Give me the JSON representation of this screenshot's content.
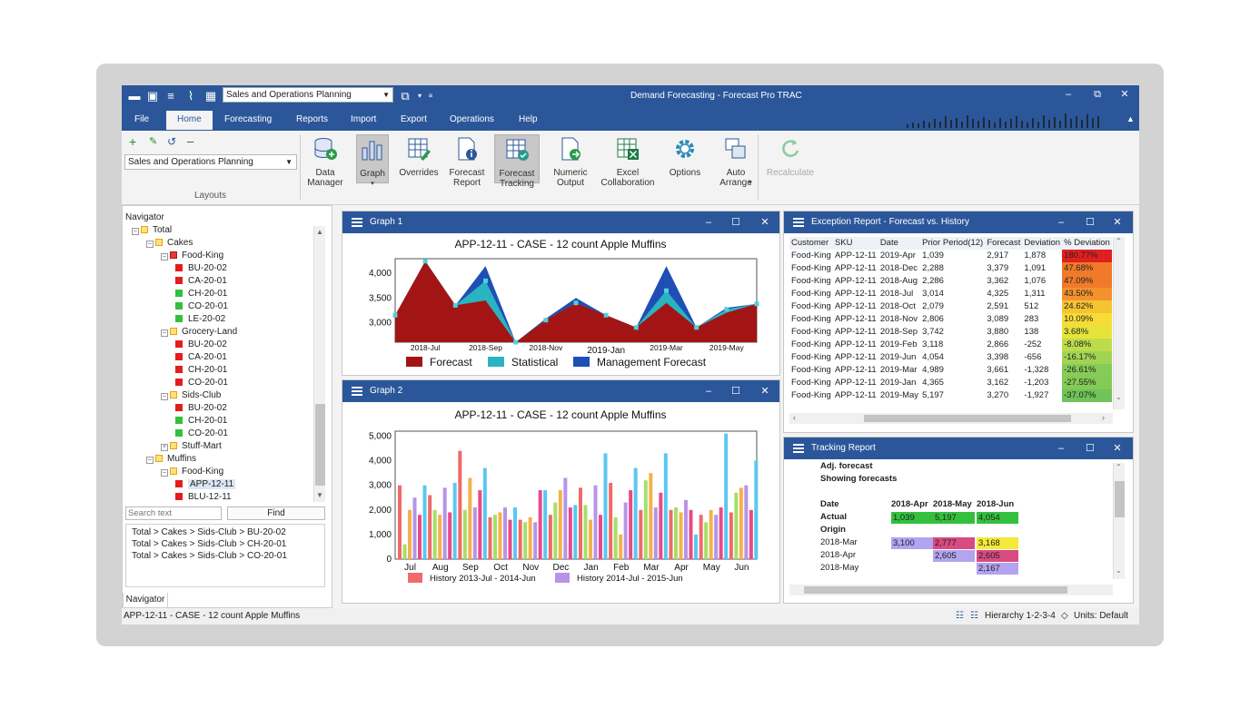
{
  "app": {
    "title": "Demand Forecasting - Forecast Pro TRAC",
    "layout_select": "Sales and Operations Planning"
  },
  "menu": {
    "tabs": [
      "File",
      "Home",
      "Forecasting",
      "Reports",
      "Import",
      "Export",
      "Operations",
      "Help"
    ],
    "active": "Home"
  },
  "ribbon": {
    "layouts_select": "Sales and Operations Planning",
    "layouts_label": "Layouts",
    "buttons": [
      {
        "label": "Data\nManager",
        "icon": "database-add-icon"
      },
      {
        "label": "Graph",
        "icon": "bar-chart-icon"
      },
      {
        "label": "Overrides",
        "icon": "grid-edit-icon"
      },
      {
        "label": "Forecast\nReport",
        "icon": "report-info-icon"
      },
      {
        "label": "Forecast\nTracking",
        "icon": "grid-tracking-icon"
      },
      {
        "label": "Numeric\nOutput",
        "icon": "document-export-icon"
      },
      {
        "label": "Excel\nCollaboration",
        "icon": "excel-icon"
      },
      {
        "label": "Options",
        "icon": "gear-icon"
      },
      {
        "label": "Auto\nArrange",
        "icon": "windows-arrange-icon"
      },
      {
        "label": "Recalculate",
        "icon": "refresh-icon"
      }
    ],
    "accent": "#2b579a"
  },
  "navigator": {
    "title": "Navigator",
    "tab_label": "Navigator",
    "search_placeholder": "Search text",
    "find_label": "Find",
    "tree": [
      {
        "label": "Total",
        "level": 0,
        "kind": "folder"
      },
      {
        "label": "Cakes",
        "level": 1,
        "kind": "folder"
      },
      {
        "label": "Food-King",
        "level": 2,
        "kind": "folder-red"
      },
      {
        "label": "BU-20-02",
        "level": 3,
        "kind": "red"
      },
      {
        "label": "CA-20-01",
        "level": 3,
        "kind": "red"
      },
      {
        "label": "CH-20-01",
        "level": 3,
        "kind": "green"
      },
      {
        "label": "CO-20-01",
        "level": 3,
        "kind": "green"
      },
      {
        "label": "LE-20-02",
        "level": 3,
        "kind": "green"
      },
      {
        "label": "Grocery-Land",
        "level": 2,
        "kind": "folder"
      },
      {
        "label": "BU-20-02",
        "level": 3,
        "kind": "red"
      },
      {
        "label": "CA-20-01",
        "level": 3,
        "kind": "red"
      },
      {
        "label": "CH-20-01",
        "level": 3,
        "kind": "red"
      },
      {
        "label": "CO-20-01",
        "level": 3,
        "kind": "red"
      },
      {
        "label": "Sids-Club",
        "level": 2,
        "kind": "folder"
      },
      {
        "label": "BU-20-02",
        "level": 3,
        "kind": "red"
      },
      {
        "label": "CH-20-01",
        "level": 3,
        "kind": "green"
      },
      {
        "label": "CO-20-01",
        "level": 3,
        "kind": "green"
      },
      {
        "label": "Stuff-Mart",
        "level": 2,
        "kind": "folder-collapsed"
      },
      {
        "label": "Muffins",
        "level": 1,
        "kind": "folder"
      },
      {
        "label": "Food-King",
        "level": 2,
        "kind": "folder"
      },
      {
        "label": "APP-12-11",
        "level": 3,
        "kind": "red-selected"
      },
      {
        "label": "BLU-12-11",
        "level": 3,
        "kind": "red"
      }
    ],
    "results": [
      "Total > Cakes > Sids-Club > BU-20-02",
      "Total > Cakes > Sids-Club > CH-20-01",
      "Total > Cakes > Sids-Club > CO-20-01"
    ]
  },
  "graph1": {
    "panel_title": "Graph 1",
    "legend": [
      {
        "name": "Forecast",
        "color": "#a31515"
      },
      {
        "name": "Statistical",
        "color": "#2ab3c0"
      },
      {
        "name": "Management Forecast",
        "color": "#1f4fb5"
      }
    ]
  },
  "graph2": {
    "panel_title": "Graph 2",
    "colors": [
      "#f06a6a",
      "#a4e06a",
      "#f5b14a",
      "#b794e6",
      "#e84a8a",
      "#5ac8f0"
    ],
    "legend": [
      {
        "name": "History 2013-Jul - 2014-Jun",
        "color": "#f06a6a"
      },
      {
        "name": "History 2014-Jul - 2015-Jun",
        "color": "#b794e6"
      }
    ]
  },
  "chart_data": [
    {
      "type": "area",
      "title": "APP-12-11 - CASE - 12 count Apple Muffins",
      "x": [
        "2018-Jun",
        "2018-Jul",
        "2018-Aug",
        "2018-Sep",
        "2018-Oct",
        "2018-Nov",
        "2018-Dec",
        "2019-Jan",
        "2019-Feb",
        "2019-Mar",
        "2019-Apr",
        "2019-May",
        "2019-Jun"
      ],
      "x_tick_labels": [
        "2018-Jul",
        "2018-Sep",
        "2018-Nov",
        "2019-Jan",
        "2019-Mar",
        "2019-May"
      ],
      "y_tick_labels": [
        "3,000",
        "3,500",
        "4,000"
      ],
      "ylim": [
        2600,
        4300
      ],
      "series": [
        {
          "name": "Forecast",
          "values": [
            3150,
            4250,
            3350,
            3450,
            2600,
            3050,
            3400,
            3150,
            2900,
            3400,
            2900,
            3200,
            3380
          ]
        },
        {
          "name": "Statistical",
          "values": [
            3150,
            4250,
            3350,
            3850,
            2600,
            3050,
            3400,
            3150,
            2900,
            3650,
            2900,
            3270,
            3380
          ]
        },
        {
          "name": "Management Forecast",
          "values": [
            3150,
            4250,
            3350,
            4150,
            2600,
            3080,
            3500,
            3150,
            2900,
            4150,
            2900,
            3300,
            3380
          ]
        }
      ]
    },
    {
      "type": "bar",
      "title": "APP-12-11 - CASE - 12 count Apple Muffins",
      "categories": [
        "Jul",
        "Aug",
        "Sep",
        "Oct",
        "Nov",
        "Dec",
        "Jan",
        "Feb",
        "Mar",
        "Apr",
        "May",
        "Jun"
      ],
      "y_tick_labels": [
        "0",
        "1,000",
        "2,000",
        "3,000",
        "4,000",
        "5,000"
      ],
      "ylim": [
        0,
        5200
      ],
      "series": [
        {
          "values": [
            3000,
            2600,
            4400,
            1700,
            1600,
            1800,
            2900,
            3100,
            2000,
            2000,
            1800,
            1900
          ]
        },
        {
          "values": [
            600,
            2000,
            2000,
            1800,
            1500,
            2300,
            2200,
            1700,
            3200,
            2100,
            1500,
            2700
          ]
        },
        {
          "values": [
            2000,
            1800,
            3300,
            1900,
            1700,
            2800,
            1600,
            1000,
            3500,
            1900,
            2000,
            2900
          ]
        },
        {
          "values": [
            2500,
            2900,
            2100,
            2100,
            1500,
            3300,
            3000,
            2300,
            2100,
            2400,
            1800,
            3000
          ]
        },
        {
          "values": [
            1800,
            1900,
            2800,
            1600,
            2800,
            2100,
            1800,
            2800,
            2700,
            2000,
            2100,
            2000
          ]
        },
        {
          "values": [
            3000,
            3100,
            3700,
            2100,
            2800,
            2200,
            4300,
            3700,
            4300,
            1000,
            5100,
            4000
          ]
        }
      ]
    }
  ],
  "exception_report": {
    "panel_title": "Exception Report - Forecast vs. History",
    "columns": [
      "Customer",
      "SKU",
      "Date",
      "Prior Period(12)",
      "Forecast",
      "Deviation",
      "% Deviation"
    ],
    "rows": [
      {
        "c": "Food-King",
        "s": "APP-12-11",
        "d": "2019-Apr",
        "p": "1,039",
        "f": "2,917",
        "v": "1,878",
        "pct": "180.77%",
        "color": "#e02020"
      },
      {
        "c": "Food-King",
        "s": "APP-12-11",
        "d": "2018-Dec",
        "p": "2,288",
        "f": "3,379",
        "v": "1,091",
        "pct": "47.68%",
        "color": "#f07a2a"
      },
      {
        "c": "Food-King",
        "s": "APP-12-11",
        "d": "2018-Aug",
        "p": "2,286",
        "f": "3,362",
        "v": "1,076",
        "pct": "47.09%",
        "color": "#f07a2a"
      },
      {
        "c": "Food-King",
        "s": "APP-12-11",
        "d": "2018-Jul",
        "p": "3,014",
        "f": "4,325",
        "v": "1,311",
        "pct": "43.50%",
        "color": "#f3922d"
      },
      {
        "c": "Food-King",
        "s": "APP-12-11",
        "d": "2018-Oct",
        "p": "2,079",
        "f": "2,591",
        "v": "512",
        "pct": "24.62%",
        "color": "#f6c431"
      },
      {
        "c": "Food-King",
        "s": "APP-12-11",
        "d": "2018-Nov",
        "p": "2,806",
        "f": "3,089",
        "v": "283",
        "pct": "10.09%",
        "color": "#f7dc37"
      },
      {
        "c": "Food-King",
        "s": "APP-12-11",
        "d": "2018-Sep",
        "p": "3,742",
        "f": "3,880",
        "v": "138",
        "pct": "3.68%",
        "color": "#e6e43a"
      },
      {
        "c": "Food-King",
        "s": "APP-12-11",
        "d": "2019-Feb",
        "p": "3,118",
        "f": "2,866",
        "v": "-252",
        "pct": "-8.08%",
        "color": "#bcdc4c"
      },
      {
        "c": "Food-King",
        "s": "APP-12-11",
        "d": "2019-Jun",
        "p": "4,054",
        "f": "3,398",
        "v": "-656",
        "pct": "-16.17%",
        "color": "#a2d454"
      },
      {
        "c": "Food-King",
        "s": "APP-12-11",
        "d": "2019-Mar",
        "p": "4,989",
        "f": "3,661",
        "v": "-1,328",
        "pct": "-26.61%",
        "color": "#86cc56"
      },
      {
        "c": "Food-King",
        "s": "APP-12-11",
        "d": "2019-Jan",
        "p": "4,365",
        "f": "3,162",
        "v": "-1,203",
        "pct": "-27.55%",
        "color": "#84cb56"
      },
      {
        "c": "Food-King",
        "s": "APP-12-11",
        "d": "2019-May",
        "p": "5,197",
        "f": "3,270",
        "v": "-1,927",
        "pct": "-37.07%",
        "color": "#6fc35a"
      }
    ]
  },
  "tracking_report": {
    "panel_title": "Tracking Report",
    "line1": "Adj. forecast",
    "line2": "Showing forecasts",
    "date_label": "Date",
    "actual_label": "Actual",
    "origin_label": "Origin",
    "columns": [
      "2018-Apr",
      "2018-May",
      "2018-Jun"
    ],
    "actual": [
      "1,039",
      "5,197",
      "4,054"
    ],
    "origins": [
      {
        "label": "2018-Mar",
        "cells": [
          {
            "v": "3,100",
            "color": "#b3a3f0"
          },
          {
            "v": "2,777",
            "color": "#d94a80"
          },
          {
            "v": "3,168",
            "color": "#f5e93a"
          }
        ]
      },
      {
        "label": "2018-Apr",
        "cells": [
          {
            "v": "",
            "color": ""
          },
          {
            "v": "2,605",
            "color": "#b3a3f0"
          },
          {
            "v": "2,605",
            "color": "#d94a80"
          }
        ]
      },
      {
        "label": "2018-May",
        "cells": [
          {
            "v": "",
            "color": ""
          },
          {
            "v": "",
            "color": ""
          },
          {
            "v": "2,167",
            "color": "#b3a3f0"
          }
        ]
      }
    ]
  },
  "status": {
    "left": "APP-12-11 - CASE - 12 count Apple Muffins",
    "hierarchy": "Hierarchy 1-2-3-4",
    "units": "Units: Default"
  }
}
